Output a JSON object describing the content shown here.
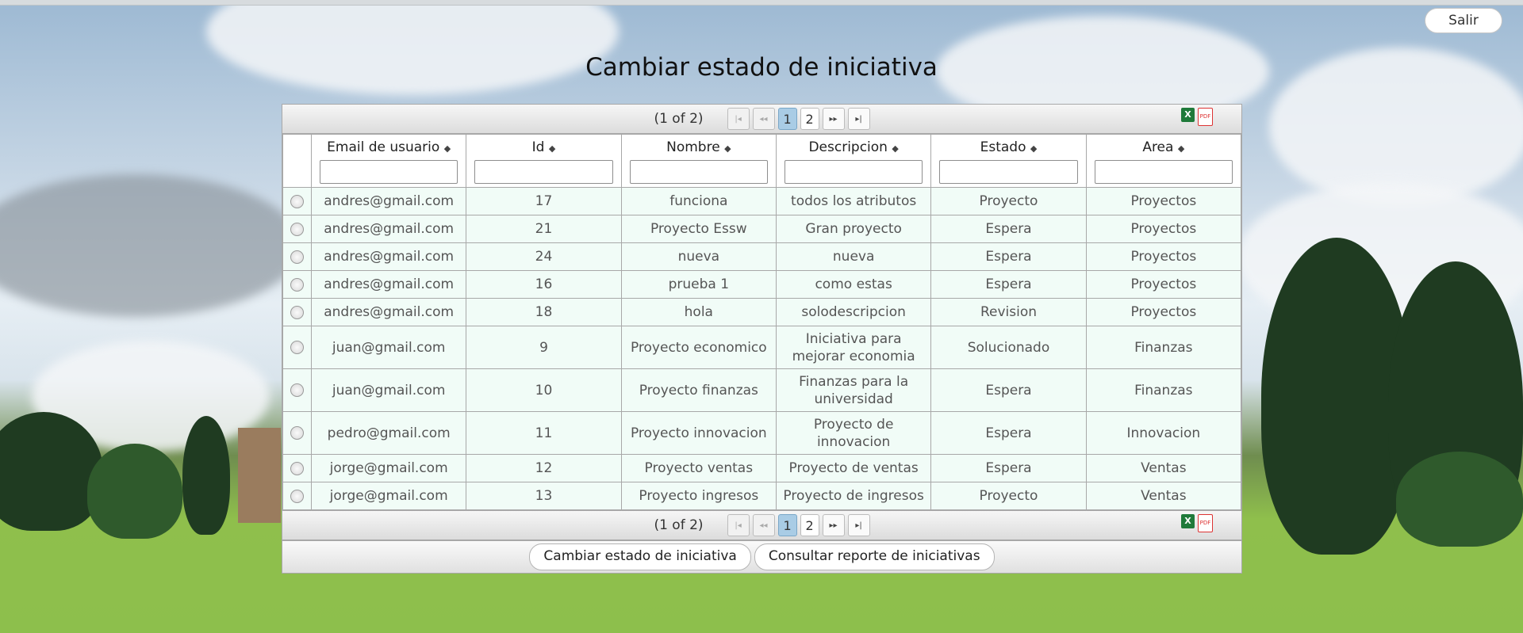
{
  "header": {
    "title": "Cambiar estado de iniciativa",
    "logout_label": "Salir"
  },
  "pager": {
    "current": "(1 of 2)",
    "pages": [
      "1",
      "2"
    ],
    "active_page": "1"
  },
  "columns": [
    {
      "label": "Email de usuario",
      "sort_icon": "sort-icon"
    },
    {
      "label": "Id",
      "sort_icon": "sort-icon"
    },
    {
      "label": "Nombre",
      "sort_icon": "sort-icon"
    },
    {
      "label": "Descripcion",
      "sort_icon": "sort-icon"
    },
    {
      "label": "Estado",
      "sort_icon": "sort-icon"
    },
    {
      "label": "Area",
      "sort_icon": "sort-icon"
    }
  ],
  "rows": [
    {
      "email": "andres@gmail.com",
      "id": "17",
      "nombre": "funciona",
      "descripcion": "todos los atributos",
      "estado": "Proyecto",
      "area": "Proyectos"
    },
    {
      "email": "andres@gmail.com",
      "id": "21",
      "nombre": "Proyecto Essw",
      "descripcion": "Gran proyecto",
      "estado": "Espera",
      "area": "Proyectos"
    },
    {
      "email": "andres@gmail.com",
      "id": "24",
      "nombre": "nueva",
      "descripcion": "nueva",
      "estado": "Espera",
      "area": "Proyectos"
    },
    {
      "email": "andres@gmail.com",
      "id": "16",
      "nombre": "prueba 1",
      "descripcion": "como estas",
      "estado": "Espera",
      "area": "Proyectos"
    },
    {
      "email": "andres@gmail.com",
      "id": "18",
      "nombre": "hola",
      "descripcion": "solodescripcion",
      "estado": "Revision",
      "area": "Proyectos"
    },
    {
      "email": "juan@gmail.com",
      "id": "9",
      "nombre": "Proyecto economico",
      "descripcion": "Iniciativa para mejorar economia",
      "estado": "Solucionado",
      "area": "Finanzas"
    },
    {
      "email": "juan@gmail.com",
      "id": "10",
      "nombre": "Proyecto finanzas",
      "descripcion": "Finanzas para la universidad",
      "estado": "Espera",
      "area": "Finanzas"
    },
    {
      "email": "pedro@gmail.com",
      "id": "11",
      "nombre": "Proyecto innovacion",
      "descripcion": "Proyecto de innovacion",
      "estado": "Espera",
      "area": "Innovacion"
    },
    {
      "email": "jorge@gmail.com",
      "id": "12",
      "nombre": "Proyecto ventas",
      "descripcion": "Proyecto de ventas",
      "estado": "Espera",
      "area": "Ventas"
    },
    {
      "email": "jorge@gmail.com",
      "id": "13",
      "nombre": "Proyecto ingresos",
      "descripcion": "Proyecto de ingresos",
      "estado": "Proyecto",
      "area": "Ventas"
    }
  ],
  "actions": {
    "change_state_label": "Cambiar estado de iniciativa",
    "report_label": "Consultar reporte de iniciativas"
  },
  "exports": {
    "excel_icon": "excel-icon",
    "pdf_icon": "pdf-icon"
  }
}
